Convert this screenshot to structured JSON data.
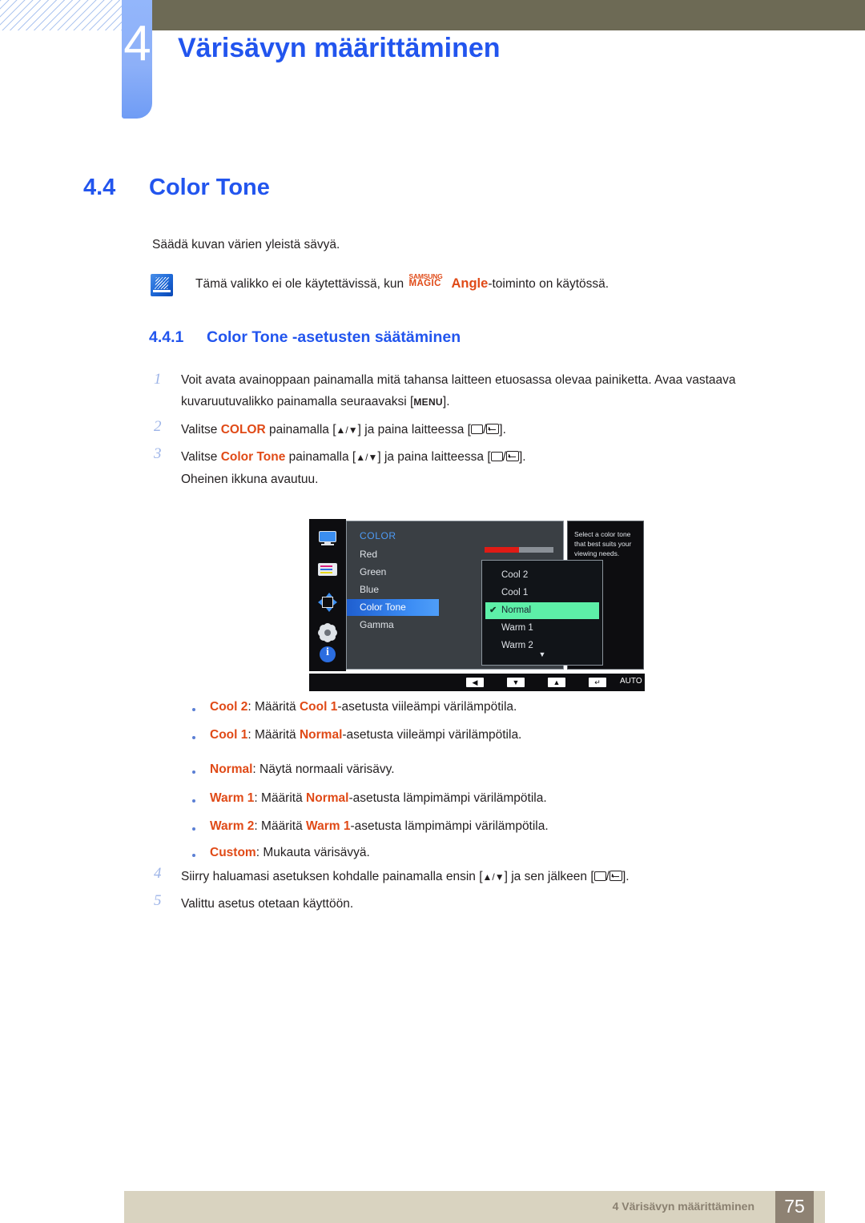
{
  "header": {
    "chapter_number": "4",
    "chapter_title": "Värisävyn määrittäminen"
  },
  "section": {
    "number": "4.4",
    "title": "Color Tone",
    "intro": "Säädä kuvan värien yleistä sävyä."
  },
  "note": {
    "icon": "note-pen-icon",
    "text_before": "Tämä valikko ei ole käytettävissä, kun ",
    "magic_top": "SAMSUNG",
    "magic_bottom": "MAGIC",
    "magic_word": "Angle",
    "text_after": "-toiminto on käytössä."
  },
  "subsection": {
    "number": "4.4.1",
    "title": "Color Tone -asetusten säätäminen"
  },
  "steps": [
    {
      "num": "1",
      "line1_a": "Voit avata avainoppaan painamalla mitä tahansa laitteen etuosassa olevaa painiketta. Avaa vastaava",
      "line2_a": "kuvaruutuvalikko painamalla seuraavaksi [",
      "key": "MENU",
      "line2_b": "]."
    },
    {
      "num": "2",
      "a": "Valitse ",
      "highlight": "COLOR",
      "b": " painamalla [",
      "arrows": "▲/▼",
      "c": "] ja paina laitteessa [",
      "d": "]."
    },
    {
      "num": "3",
      "a": "Valitse ",
      "highlight": "Color Tone",
      "b": " painamalla [",
      "arrows": "▲/▼",
      "c": "] ja paina laitteessa [",
      "d": "].",
      "follow": "Oheinen ikkuna avautuu."
    },
    {
      "num": "4",
      "a": "Siirry haluamasi asetuksen kohdalle painamalla ensin [",
      "arrows": "▲/▼",
      "c": "] ja sen jälkeen [",
      "d": "]."
    },
    {
      "num": "5",
      "a": "Valittu asetus otetaan käyttöön."
    }
  ],
  "osd": {
    "menu_title": "COLOR",
    "items": [
      {
        "label": "Red",
        "selected": false
      },
      {
        "label": "Green",
        "selected": false
      },
      {
        "label": "Blue",
        "selected": false
      },
      {
        "label": "Color Tone",
        "selected": true
      },
      {
        "label": "Gamma",
        "selected": false
      }
    ],
    "slider": {
      "value": "50",
      "fill_percent": 50,
      "fill_color": "#e01b15",
      "track_color": "#8a9097"
    },
    "help_text": "Select a color tone that best suits your viewing needs.",
    "dropdown": {
      "options": [
        {
          "label": "Cool 2",
          "selected": false
        },
        {
          "label": "Cool 1",
          "selected": false
        },
        {
          "label": "Normal",
          "selected": true
        },
        {
          "label": "Warm 1",
          "selected": false
        },
        {
          "label": "Warm 2",
          "selected": false
        }
      ],
      "check_glyph": "✔",
      "more_glyph": "▼",
      "highlight_color": "#5df0a8"
    },
    "sidebar_icons": [
      "picture-icon",
      "color-icon",
      "size-position-icon",
      "setup-icon",
      "information-icon"
    ],
    "bottom_buttons": [
      {
        "name": "left-button",
        "glyph": "◀"
      },
      {
        "name": "down-button",
        "glyph": "▼"
      },
      {
        "name": "up-button",
        "glyph": "▲"
      },
      {
        "name": "enter-button",
        "glyph": "↵"
      },
      {
        "name": "auto-button",
        "glyph": "AUTO"
      },
      {
        "name": "power-button",
        "glyph": "⏻"
      }
    ]
  },
  "bullets": [
    {
      "term": "Cool 2",
      "mid": ": Määritä ",
      "term2": "Cool 1",
      "rest": "-asetusta viileämpi värilämpötila."
    },
    {
      "term": "Cool 1",
      "mid": ": Määritä ",
      "term2": "Normal",
      "rest": "-asetusta viileämpi värilämpötila."
    },
    {
      "term": "Normal",
      "mid": ": Näytä normaali värisävy.",
      "term2": "",
      "rest": ""
    },
    {
      "term": "Warm 1",
      "mid": ": Määritä ",
      "term2": "Normal",
      "rest": "-asetusta lämpimämpi värilämpötila."
    },
    {
      "term": "Warm 2",
      "mid": ": Määritä ",
      "term2": "Warm 1",
      "rest": "-asetusta lämpimämpi värilämpötila."
    },
    {
      "term": "Custom",
      "mid": ": Mukauta värisävyä.",
      "term2": "",
      "rest": ""
    }
  ],
  "footer": {
    "text": "4 Värisävyn määrittäminen",
    "page": "75"
  },
  "colors": {
    "accent_blue": "#2255ee",
    "orange": "#e04a17",
    "olive": "#6d6a55",
    "footer_bg": "#d9d3c0",
    "page_box": "#8e8273"
  }
}
